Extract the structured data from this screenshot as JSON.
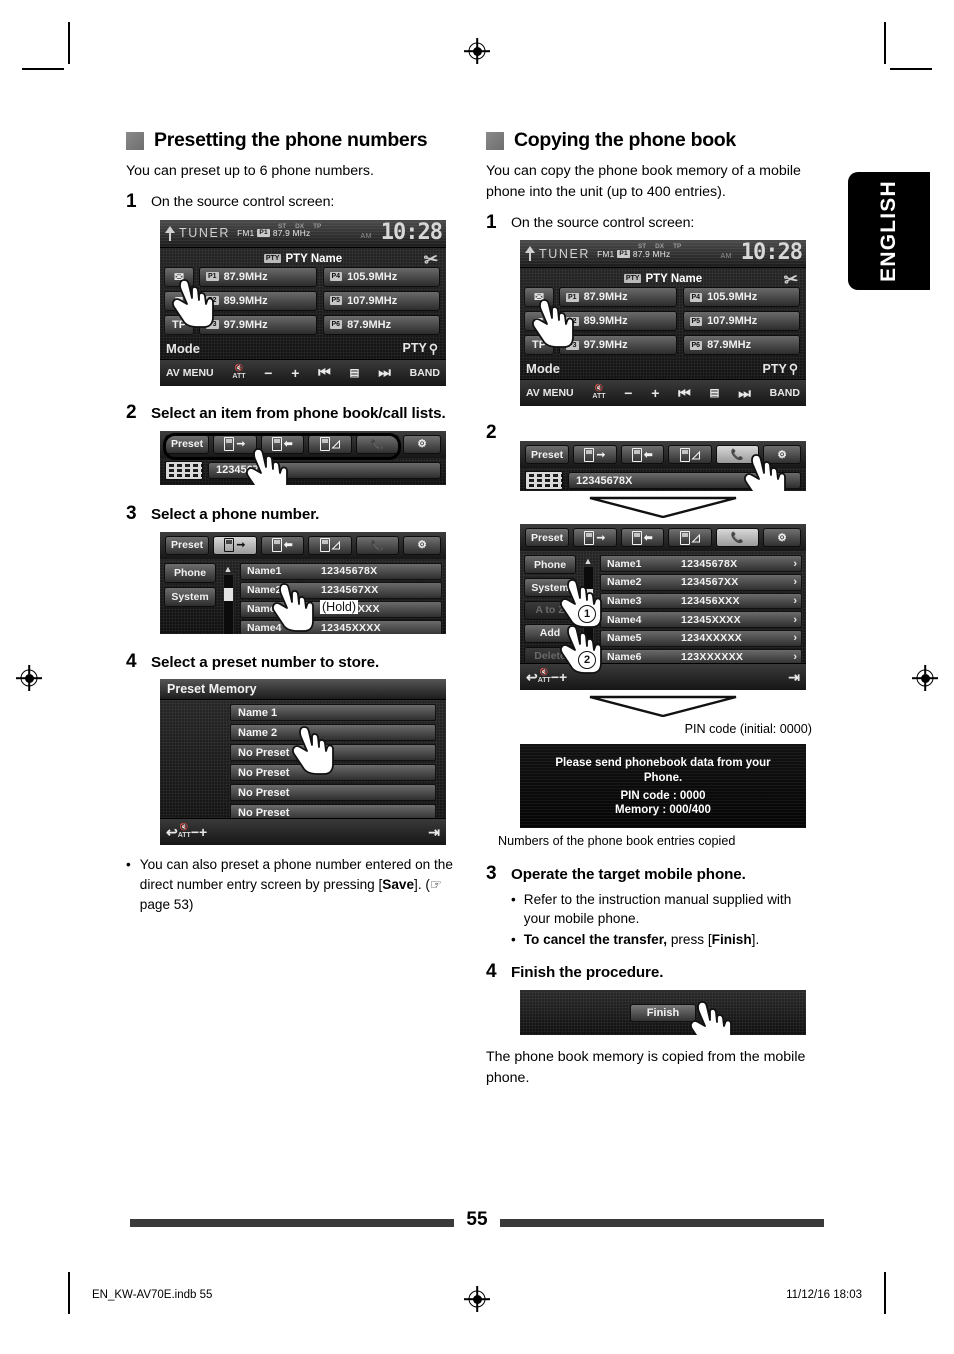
{
  "page": {
    "language_tab": "ENGLISH",
    "page_number": "55",
    "footer_left": "EN_KW-AV70E.indb   55",
    "footer_right": "11/12/16   18:03"
  },
  "left_section": {
    "title": "Presetting the phone numbers",
    "intro": "You can preset up to 6 phone numbers.",
    "steps": [
      {
        "num": "1",
        "text": "On the source control screen:"
      },
      {
        "num": "2",
        "text": "Select an item from phone book/call lists."
      },
      {
        "num": "3",
        "text": "Select a phone number."
      },
      {
        "num": "4",
        "text": "Select a preset number to store."
      }
    ],
    "note": {
      "bullet": "•",
      "text_before": "You can also preset a phone number entered on the direct number entry screen by pressing [",
      "bold": "Save",
      "text_after": "]. (",
      "page_ref": "page 53)"
    }
  },
  "right_section": {
    "title": "Copying the phone book",
    "intro": "You can copy the phone book memory of a mobile phone into the unit (up to 400 entries).",
    "steps": [
      {
        "num": "1",
        "text": "On the source control screen:"
      },
      {
        "num": "2",
        "text": ""
      },
      {
        "num": "3",
        "text": "Operate the target mobile phone."
      },
      {
        "num": "4",
        "text": "Finish the procedure."
      }
    ],
    "step3_bullets": [
      {
        "dot": "•",
        "text": "Refer to the instruction manual supplied with your mobile phone."
      },
      {
        "dot": "•",
        "bold": "To cancel the transfer,",
        "rest": " press [",
        "bold2": "Finish",
        "rest2": "]."
      }
    ],
    "closing": "The phone book memory is copied from the mobile phone.",
    "callouts": {
      "pin": "PIN code (initial: 0000)",
      "memory": "Numbers of the phone book entries copied"
    }
  },
  "tuner_screen": {
    "source": "TUNER",
    "band": "FM1",
    "preset_badge": "P1",
    "frequency": "87.9 MHz",
    "flags": [
      "ST",
      "DX",
      "TP"
    ],
    "clock": "10:28",
    "ampm": "AM",
    "pty_badge": "PTY",
    "pty_label": "PTY Name",
    "scissors_icon": "✂",
    "side_buttons": [
      "bluetooth-icon",
      "keypad-icon",
      "TP"
    ],
    "presets_left": [
      {
        "num": "P1",
        "freq": "87.9MHz"
      },
      {
        "num": "P2",
        "freq": "89.9MHz"
      },
      {
        "num": "P3",
        "freq": "97.9MHz"
      }
    ],
    "presets_right": [
      {
        "num": "P4",
        "freq": "105.9MHz"
      },
      {
        "num": "P5",
        "freq": "107.9MHz"
      },
      {
        "num": "P6",
        "freq": "87.9MHz"
      }
    ],
    "mode_label": "Mode",
    "pty_button": "PTY",
    "bottom_bar": {
      "av_menu": "AV MENU",
      "att": "ATT",
      "minus": "−",
      "plus": "+",
      "prev": "⏮",
      "disp": "▤",
      "next": "⏭",
      "band": "BAND"
    }
  },
  "phone_toolbar": {
    "preset_label": "Preset",
    "icons": [
      "dialed-calls-icon",
      "received-calls-icon",
      "missed-calls-icon",
      "phonebook-icon",
      "phone-settings-icon"
    ],
    "number_value": "12345678X"
  },
  "phone_list_screen": {
    "nav": [
      "Phone",
      "System",
      "A to Z",
      "Add",
      "Delete"
    ],
    "rows": [
      {
        "name": "Name1",
        "number": "12345678X"
      },
      {
        "name": "Name2",
        "number": "1234567XX"
      },
      {
        "name": "Name3",
        "number": "123456XXX"
      },
      {
        "name": "Name4",
        "number": "12345XXXX"
      },
      {
        "name": "Name5",
        "number": "1234XXXXX"
      },
      {
        "name": "Name6",
        "number": "123XXXXXX"
      }
    ],
    "chevron": "›",
    "bottom": {
      "back": "↩",
      "att": "ATT",
      "minus": "−",
      "plus": "+",
      "exit": "⇥"
    },
    "hold_label": "(Hold)",
    "badge_1": "1",
    "badge_2": "2"
  },
  "phone_list_short": {
    "nav": [
      "Phone",
      "System"
    ],
    "rows": [
      {
        "name": "Name1",
        "number": "12345678X"
      },
      {
        "name": "Name2",
        "number": "1234567XX"
      },
      {
        "name": "Name3",
        "number": "123456XXX"
      },
      {
        "name": "Name4",
        "number": "12345XXXX"
      }
    ]
  },
  "preset_memory_screen": {
    "title": "Preset Memory",
    "items": [
      "Name 1",
      "Name 2",
      "No Preset",
      "No Preset",
      "No Preset",
      "No Preset"
    ],
    "bottom": {
      "back": "↩",
      "att": "ATT",
      "minus": "−",
      "plus": "+",
      "exit": "⇥"
    }
  },
  "message_dialog": {
    "line1": "Please send phonebook data from your",
    "line1b": "Phone.",
    "line2": "PIN code : 0000",
    "line3": "Memory : 000/400"
  },
  "finish_screen": {
    "button_label": "Finish"
  }
}
